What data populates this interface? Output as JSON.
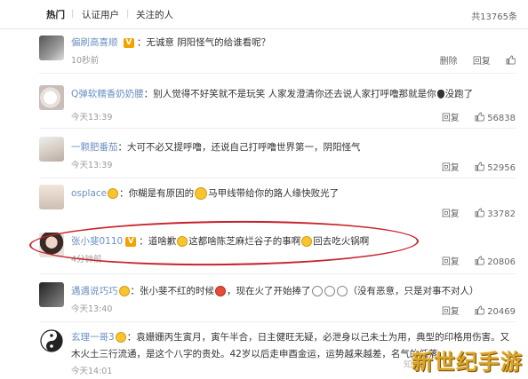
{
  "tabs": [
    "热门",
    "认证用户",
    "关注的人"
  ],
  "total": "共13765条",
  "comments": [
    {
      "name": "偏刷高喜顺",
      "verified_mark": "V",
      "text": "无诚意 阴阳怪气的给谁看呢？",
      "time": "10秒前",
      "actions": [
        "删除",
        "回复"
      ],
      "likes": ""
    },
    {
      "name": "Q弹软糯香奶奶腰",
      "text": "别人觉得不好笑就不是玩笑 人家发澄清你还去说人家打呼噜那就是你",
      "text_tail": "没跑了",
      "time": "今天13:39",
      "actions": [
        "回复"
      ],
      "likes": "56838"
    },
    {
      "name": "一颗肥番茄",
      "text": "大可不必又提呼噜，还说自己打呼噜世界第一，阴阳怪气",
      "time": "今天13:39",
      "actions": [
        "回复"
      ],
      "likes": "52956"
    },
    {
      "name": "osplace",
      "text": "你糊是有原因的",
      "text_tail": "马甲线带给你的路人缘快败光了",
      "time": "今天13:39",
      "actions": [
        "回复"
      ],
      "likes": "33782"
    },
    {
      "name": "张小斐0110",
      "verified_mark": "V",
      "text": "道啥歉",
      "text_mid": "这都啥陈芝麻烂谷子的事啊",
      "text_tail": "回去吃火锅啊",
      "time": "4分钟前",
      "actions": [
        "回复"
      ],
      "likes": "20806"
    },
    {
      "name": "遇遇说巧巧",
      "text": "张小斐不红的时候",
      "text_mid": "，现在火了开始捧了",
      "text_tail": "（没有恶意，只是对事不对人）",
      "time": "今天13:40",
      "actions": [
        "回复"
      ],
      "likes": "20469"
    },
    {
      "name": "玄理一哥3",
      "text": "袁姗姗丙生寅月，寅午半合，日主健旺无疑，必泄身以己未土为用，典型的印格用伤害。又",
      "text_line2": "木火土三行流通，是这个八字的贵处。42岁以后走申酉金运，运势越来越差，名气的低落。",
      "time": "今天14:01",
      "actions": [
        "回复"
      ],
      "likes": ""
    }
  ],
  "watermark": "新世纪手游",
  "small_logo": "知乎"
}
